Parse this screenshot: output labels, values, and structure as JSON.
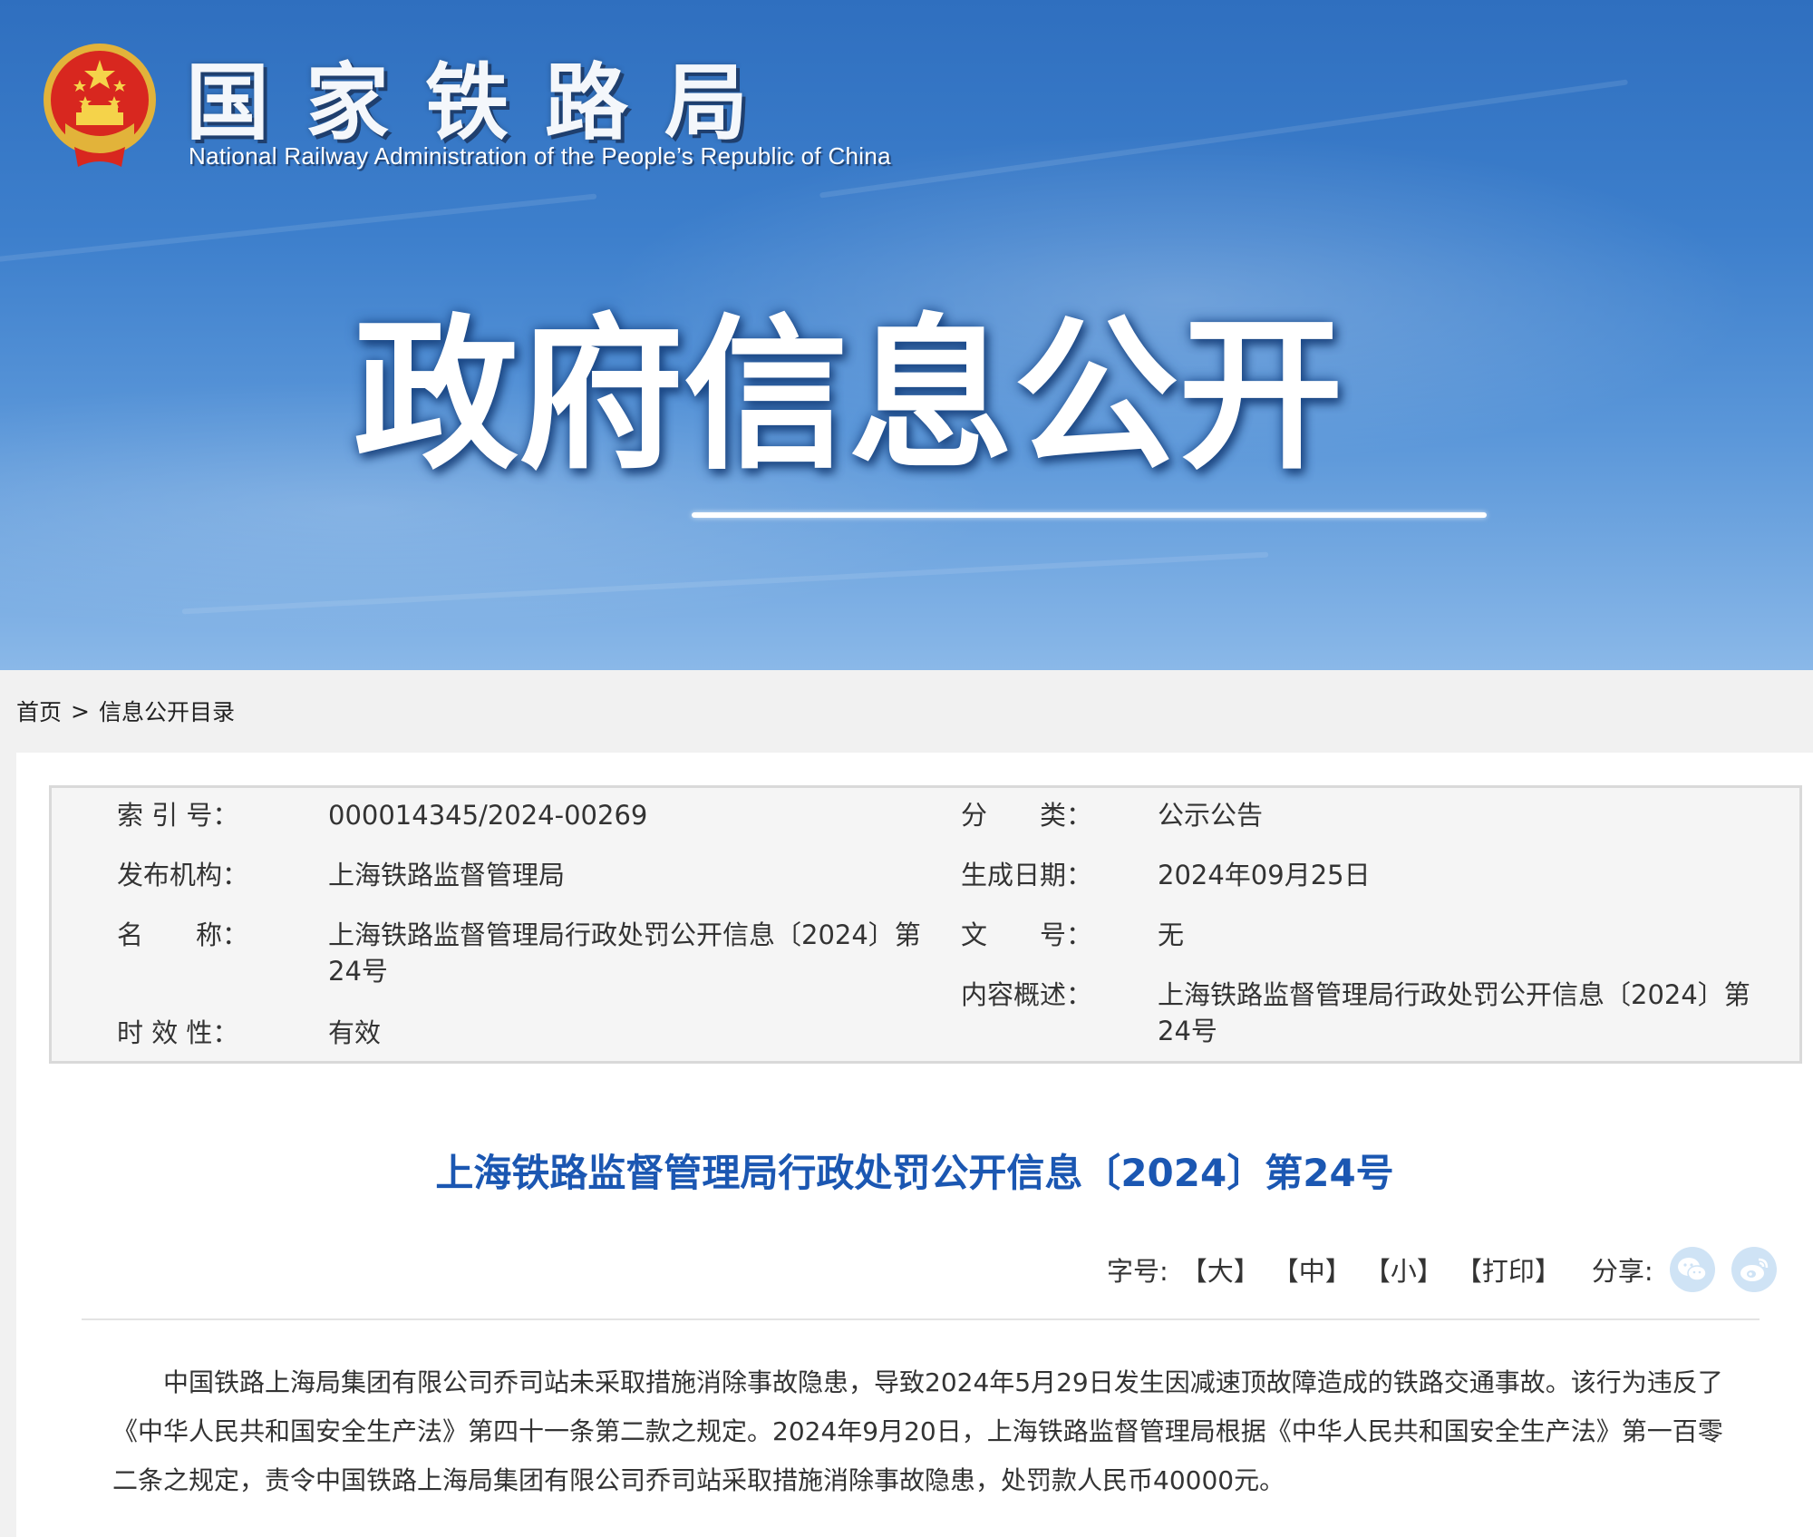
{
  "header": {
    "logo_cn": [
      "国",
      "家",
      "铁",
      "路",
      "局"
    ],
    "logo_en": "National Railway Administration of the People’s Republic of China",
    "banner_title": [
      "政",
      "府",
      "信",
      "息",
      "公",
      "开"
    ],
    "emblem_icon": "national-emblem-icon"
  },
  "breadcrumb": {
    "home": "首页",
    "separator": ">",
    "current": "信息公开目录"
  },
  "info": {
    "index_label": "索 引 号：",
    "index_value": "000014345/2024-00269",
    "category_label": "分　　类：",
    "category_value": "公示公告",
    "publisher_label": "发布机构：",
    "publisher_value": "上海铁路监督管理局",
    "date_label": "生成日期：",
    "date_value": "2024年09月25日",
    "name_label": "名　　称：",
    "name_value": "上海铁路监督管理局行政处罚公开信息〔2024〕第24号",
    "doc_no_label": "文　　号：",
    "doc_no_value": "无",
    "summary_label": "内容概述：",
    "summary_value": "上海铁路监督管理局行政处罚公开信息〔2024〕第24号",
    "validity_label": "时 效 性：",
    "validity_value": "有效"
  },
  "article": {
    "title": "上海铁路监督管理局行政处罚公开信息〔2024〕第24号",
    "body": "中国铁路上海局集团有限公司乔司站未采取措施消除事故隐患，导致2024年5月29日发生因减速顶故障造成的铁路交通事故。该行为违反了《中华人民共和国安全生产法》第四十一条第二款之规定。2024年9月20日，上海铁路监督管理局根据《中华人民共和国安全生产法》第一百零二条之规定，责令中国铁路上海局集团有限公司乔司站采取措施消除事故隐患，处罚款人民币40000元。"
  },
  "tools": {
    "font_size_label": "字号:",
    "large": "【大】",
    "medium": "【中】",
    "small": "【小】",
    "print": "【打印】",
    "share_label": "分享:",
    "share_icons": [
      "wechat-icon",
      "weibo-icon"
    ]
  },
  "colors": {
    "title_blue": "#1b57b2",
    "banner_blue": "#3d7fcc",
    "share_icon_bg": "#cfe3f5"
  }
}
